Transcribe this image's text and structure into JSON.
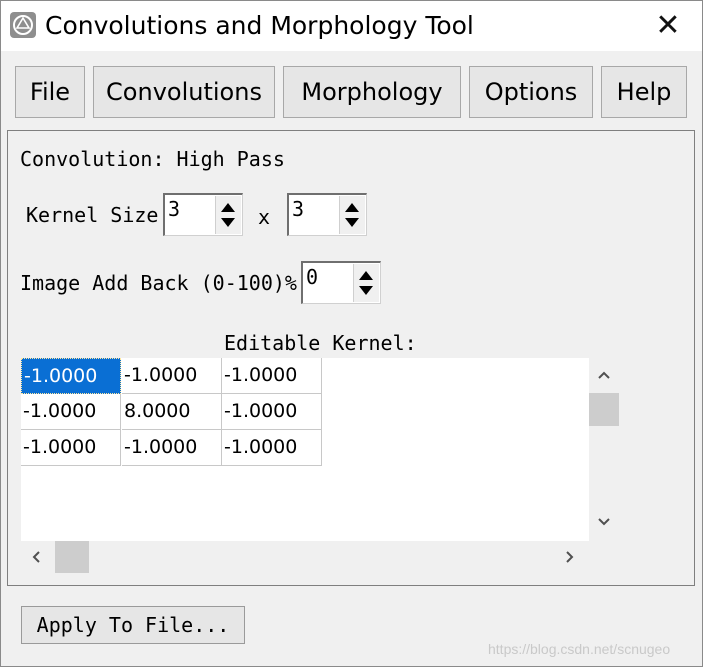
{
  "window": {
    "title": "Convolutions and Morphology Tool",
    "close_glyph": "✕",
    "app_icon": "app-icon"
  },
  "menu": {
    "items": [
      {
        "label": "File"
      },
      {
        "label": "Convolutions"
      },
      {
        "label": "Morphology"
      },
      {
        "label": "Options"
      },
      {
        "label": "Help"
      }
    ]
  },
  "panel": {
    "convolution_label": "Convolution: High Pass",
    "kernel_size_label": "Kernel Size",
    "kernel_rows": "3",
    "kernel_x": "x",
    "kernel_cols": "3",
    "add_back_label": "Image Add Back (0-100)%",
    "add_back_value": "0",
    "editable_kernel_label": "Editable Kernel:"
  },
  "kernel": {
    "rows": [
      [
        "-1.0000",
        "-1.0000",
        "-1.0000"
      ],
      [
        "-1.0000",
        "8.0000",
        "-1.0000"
      ],
      [
        "-1.0000",
        "-1.0000",
        "-1.0000"
      ]
    ],
    "selected_cell": "0,0"
  },
  "scroll": {
    "up": "⌃",
    "down": "⌄",
    "left": "‹",
    "right": "›"
  },
  "apply_button": "Apply To File...",
  "watermark": "https://blog.csdn.net/scnugeo",
  "colors": {
    "selection": "#0a6fd4",
    "background": "#f0f0f0"
  }
}
